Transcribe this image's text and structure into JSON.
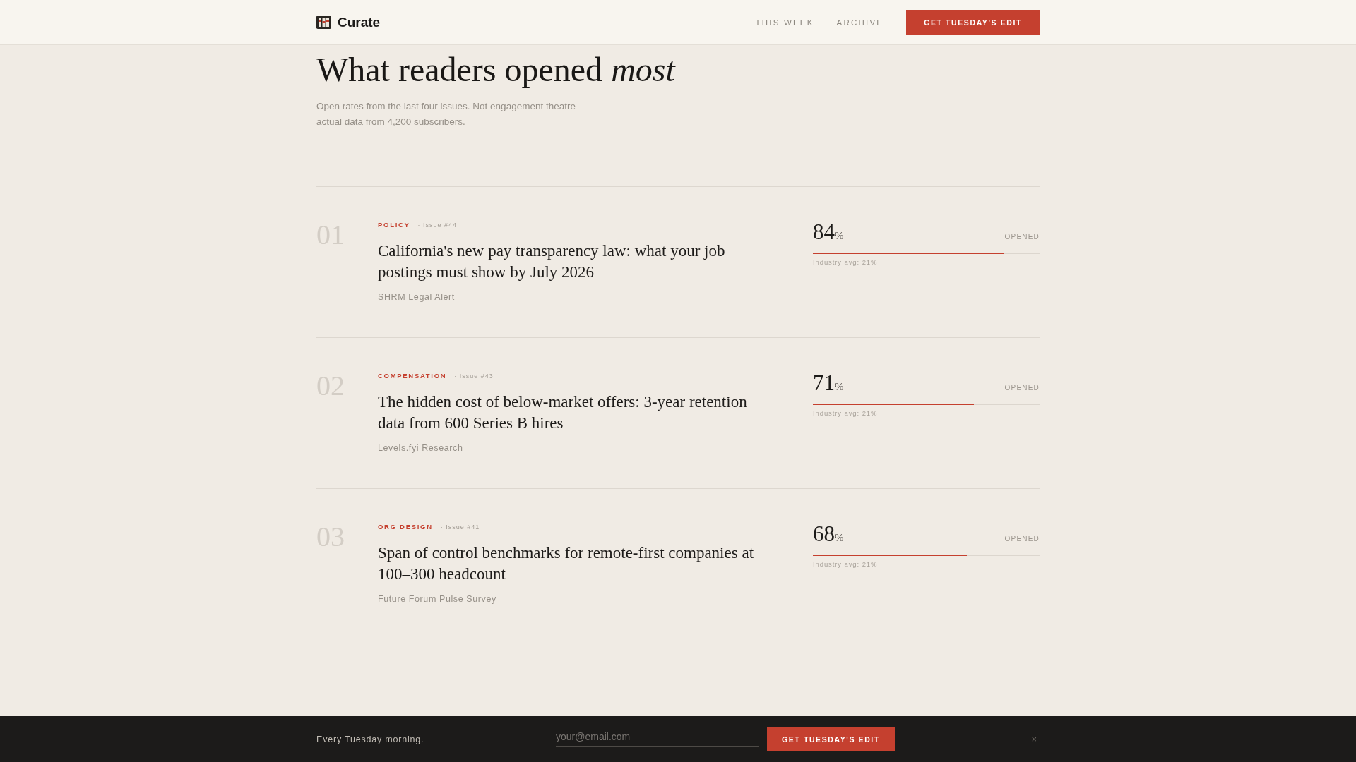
{
  "header": {
    "brand": "Curate",
    "nav": [
      {
        "label": "THIS WEEK"
      },
      {
        "label": "ARCHIVE"
      }
    ],
    "cta": "GET TUESDAY'S EDIT"
  },
  "intro": {
    "title": "What readers opened *most*",
    "subtitle": "Open rates from the last four issues. Not engagement theatre — actual data from 4,200 subscribers."
  },
  "stories": [
    {
      "rank": "01",
      "category": "POLICY",
      "issue": "· Issue #44",
      "title": "California's new pay transparency law: what your job postings must show by July 2026",
      "source": "SHRM Legal Alert",
      "value": "84",
      "unit": "%",
      "status": "OPENED",
      "level": 0.84,
      "benchmark": "Industry avg: 21%"
    },
    {
      "rank": "02",
      "category": "COMPENSATION",
      "issue": "· Issue #43",
      "title": "The hidden cost of below-market offers: 3-year retention data from 600 Series B hires",
      "source": "Levels.fyi Research",
      "value": "71",
      "unit": "%",
      "status": "OPENED",
      "level": 0.71,
      "benchmark": "Industry avg: 21%"
    },
    {
      "rank": "03",
      "category": "ORG DESIGN",
      "issue": "· Issue #41",
      "title": "Span of control benchmarks for remote-first companies at 100–300 headcount",
      "source": "Future Forum Pulse Survey",
      "value": "68",
      "unit": "%",
      "status": "OPENED",
      "level": 0.68,
      "benchmark": "Industry avg: 21%"
    }
  ],
  "footer": {
    "tagline": "Every Tuesday morning.",
    "email": {
      "placeholder": "your@email.com"
    },
    "cta": "GET TUESDAY'S EDIT",
    "close": "×"
  }
}
